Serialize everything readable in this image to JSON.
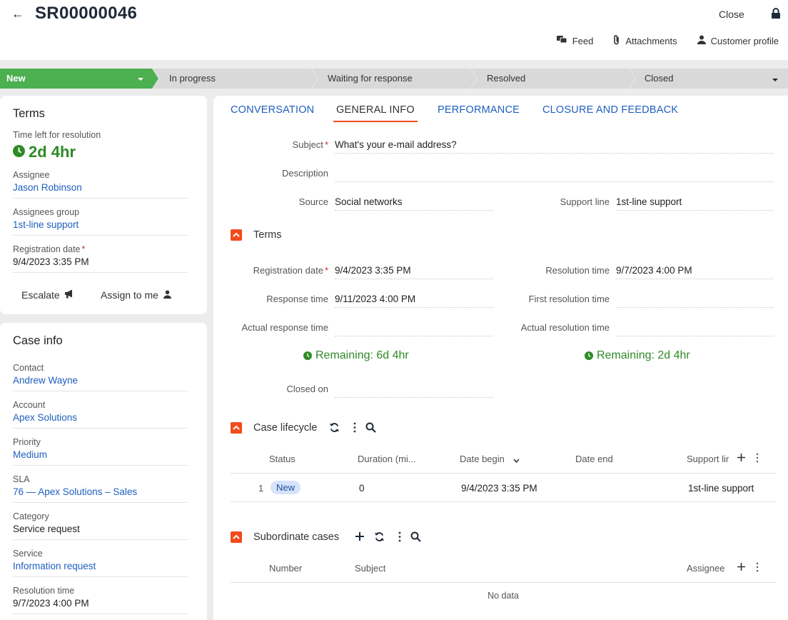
{
  "header": {
    "title": "SR00000046",
    "close_label": "Close",
    "links": [
      {
        "label": "Feed",
        "icon": "feed-icon"
      },
      {
        "label": "Attachments",
        "icon": "paperclip-icon"
      },
      {
        "label": "Customer profile",
        "icon": "person-icon"
      }
    ]
  },
  "stages": {
    "items": [
      "New",
      "In progress",
      "Waiting for response",
      "Resolved",
      "Closed"
    ],
    "active_color": "#4caf50"
  },
  "terms_card": {
    "title": "Terms",
    "time_left_label": "Time left for resolution",
    "time_left_value": "2d 4hr",
    "assignee_label": "Assignee",
    "assignee_value": "Jason Robinson",
    "group_label": "Assignees group",
    "group_value": "1st-line support",
    "reg_label": "Registration date",
    "reg_value": "9/4/2023 3:35 PM",
    "escalate_label": "Escalate",
    "assign_label": "Assign to me"
  },
  "case_info": {
    "title": "Case info",
    "contact_label": "Contact",
    "contact_value": "Andrew Wayne",
    "account_label": "Account",
    "account_value": "Apex Solutions",
    "priority_label": "Priority",
    "priority_value": "Medium",
    "sla_label": "SLA",
    "sla_value": "76 — Apex Solutions – Sales",
    "category_label": "Category",
    "category_value": "Service request",
    "service_label": "Service",
    "service_value": "Information request",
    "resolution_label": "Resolution time",
    "resolution_value": "9/7/2023 4:00 PM"
  },
  "tabs": [
    "CONVERSATION",
    "GENERAL INFO",
    "PERFORMANCE",
    "CLOSURE AND FEEDBACK"
  ],
  "general": {
    "subject_label": "Subject",
    "subject_value": "What's your e-mail address?",
    "description_label": "Description",
    "description_value": "",
    "source_label": "Source",
    "source_value": "Social networks",
    "support_line_label": "Support line",
    "support_line_value": "1st-line support"
  },
  "terms_section": {
    "title": "Terms",
    "reg_label": "Registration date",
    "reg_value": "9/4/2023 3:35 PM",
    "resolution_label": "Resolution time",
    "resolution_value": "9/7/2023 4:00 PM",
    "response_label": "Response time",
    "response_value": "9/11/2023 4:00 PM",
    "first_res_label": "First resolution time",
    "first_res_value": "",
    "actual_resp_label": "Actual response time",
    "actual_resp_value": "",
    "actual_res_label": "Actual resolution time",
    "actual_res_value": "",
    "remaining_response": "Remaining: 6d 4hr",
    "remaining_resolution": "Remaining: 2d 4hr",
    "closed_on_label": "Closed on",
    "closed_on_value": ""
  },
  "lifecycle": {
    "title": "Case lifecycle",
    "columns": [
      "Status",
      "Duration (mi...",
      "Date begin",
      "Date end",
      "Support lir"
    ],
    "rows": [
      {
        "num": "1",
        "status": "New",
        "duration": "0",
        "date_begin": "9/4/2023 3:35 PM",
        "date_end": "",
        "support_line": "1st-line support"
      }
    ]
  },
  "subordinate": {
    "title": "Subordinate cases",
    "columns": [
      "Number",
      "Subject",
      "Assignee"
    ],
    "empty_text": "No data"
  },
  "colors": {
    "accent_blue": "#1f5fbf",
    "success_green": "#2e8b26",
    "section_orange": "#f24c1d",
    "tab_underline": "#f24c1d"
  }
}
